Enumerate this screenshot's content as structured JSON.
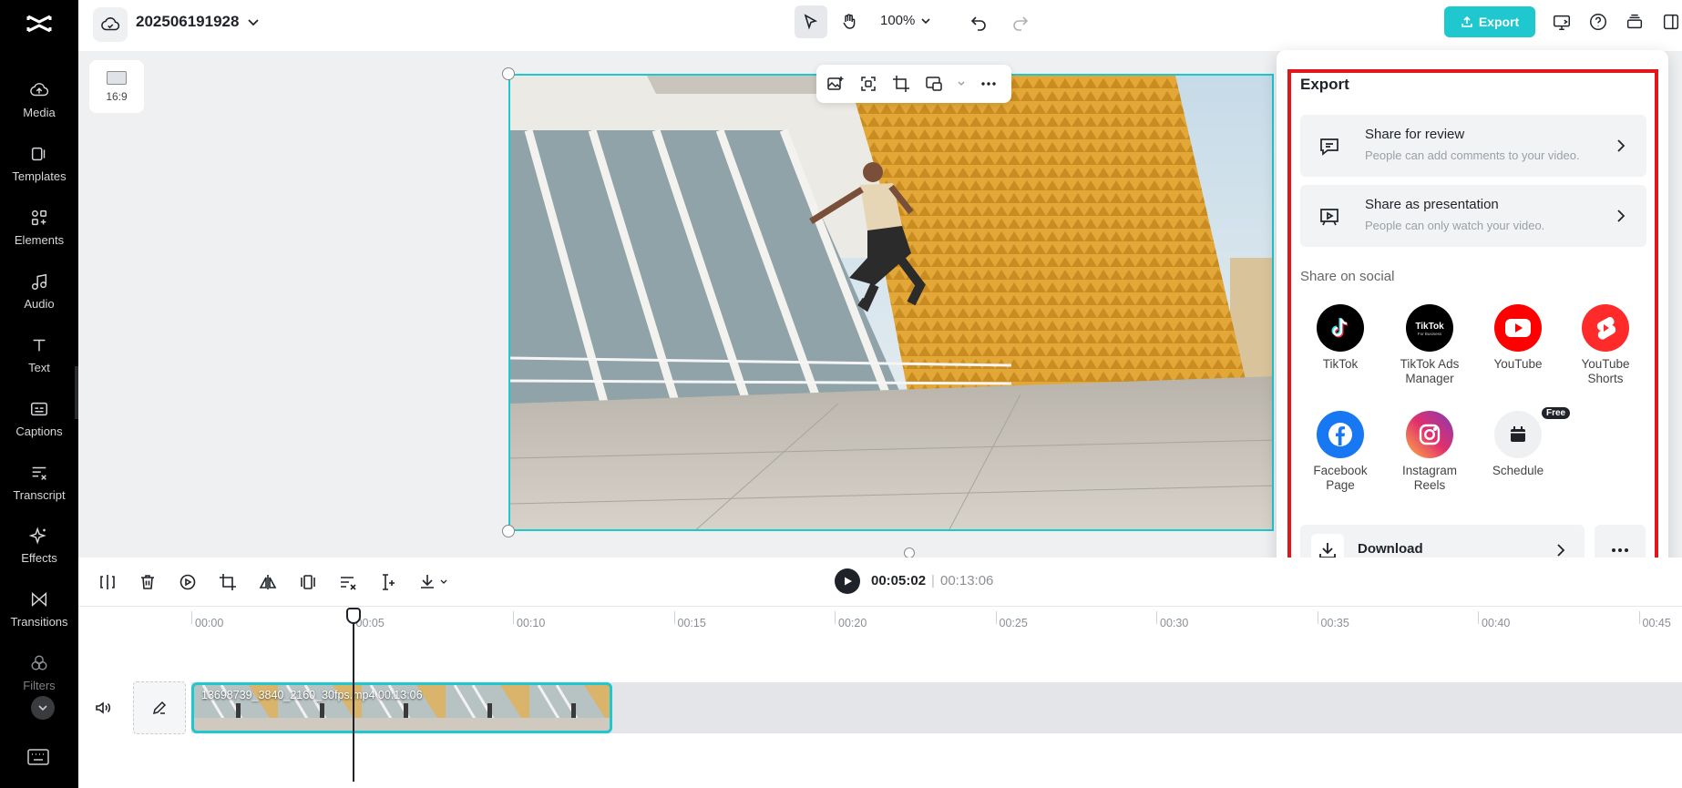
{
  "project": {
    "title": "202506191928"
  },
  "toolbar": {
    "zoom": "100%",
    "export_label": "Export"
  },
  "sidebar": {
    "items": [
      {
        "label": "Media",
        "icon": "cloud-upload-icon"
      },
      {
        "label": "Templates",
        "icon": "templates-icon"
      },
      {
        "label": "Elements",
        "icon": "elements-icon"
      },
      {
        "label": "Audio",
        "icon": "music-note-icon"
      },
      {
        "label": "Text",
        "icon": "text-t-icon"
      },
      {
        "label": "Captions",
        "icon": "captions-icon"
      },
      {
        "label": "Transcript",
        "icon": "transcript-icon"
      },
      {
        "label": "Effects",
        "icon": "sparkle-icon"
      },
      {
        "label": "Transitions",
        "icon": "transition-icon"
      },
      {
        "label": "Filters",
        "icon": "filters-icon"
      }
    ]
  },
  "canvas": {
    "ratio_label": "16:9"
  },
  "export_panel": {
    "title": "Export",
    "share_review": {
      "title": "Share for review",
      "subtitle": "People can add comments to your video."
    },
    "share_presentation": {
      "title": "Share as presentation",
      "subtitle": "People can only watch your video."
    },
    "social_title": "Share on social",
    "socials": [
      {
        "label": "TikTok",
        "color": "#000000"
      },
      {
        "label": "TikTok Ads Manager",
        "color": "#000000"
      },
      {
        "label": "YouTube",
        "color": "#ff0000"
      },
      {
        "label": "YouTube Shorts",
        "color": "#ff2b2b"
      },
      {
        "label": "Facebook Page",
        "color": "#1877f2"
      },
      {
        "label": "Instagram Reels",
        "color": "#e1306c"
      },
      {
        "label": "Schedule",
        "color": "#eef0f2",
        "badge": "Free"
      }
    ],
    "download_label": "Download"
  },
  "playback": {
    "current_time": "00:05:02",
    "separator": "|",
    "total_time": "00:13:06"
  },
  "timeline": {
    "ruler": [
      "00:00",
      "00:05",
      "00:10",
      "00:15",
      "00:20",
      "00:25",
      "00:30",
      "00:35",
      "00:40",
      "00:45"
    ],
    "clip_label": "13698739_3840_2160_30fps.mp4   00:13:06"
  },
  "colors": {
    "accent": "#1fc7cf",
    "highlight_box": "#e0161b"
  }
}
